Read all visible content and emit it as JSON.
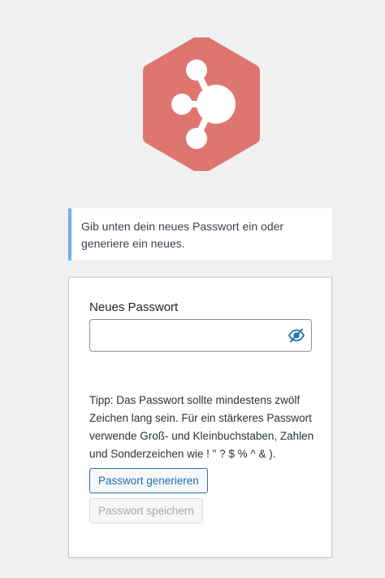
{
  "colors": {
    "page_background": "#f0f0f1",
    "logo": "#de7670",
    "notice_accent": "#72aee6",
    "primary": "#2271b1",
    "disabled_text": "#a7aaad"
  },
  "logo": {
    "icon": "share-hexagon-icon"
  },
  "notice": {
    "message": "Gib unten dein neues Passwort ein oder generiere ein neues."
  },
  "form": {
    "password_label": "Neues Passwort",
    "password_value": "",
    "visibility_icon": "eye-slash-icon",
    "hint": "Tipp: Das Passwort sollte mindestens zwölf Zeichen lang sein. Für ein stärkeres Passwort verwende Groß- und Kleinbuchstaben, Zahlen und Sonderzeichen wie ! \" ? $ % ^ & ).",
    "generate_button": "Passwort generieren",
    "save_button": "Passwort speichern"
  }
}
